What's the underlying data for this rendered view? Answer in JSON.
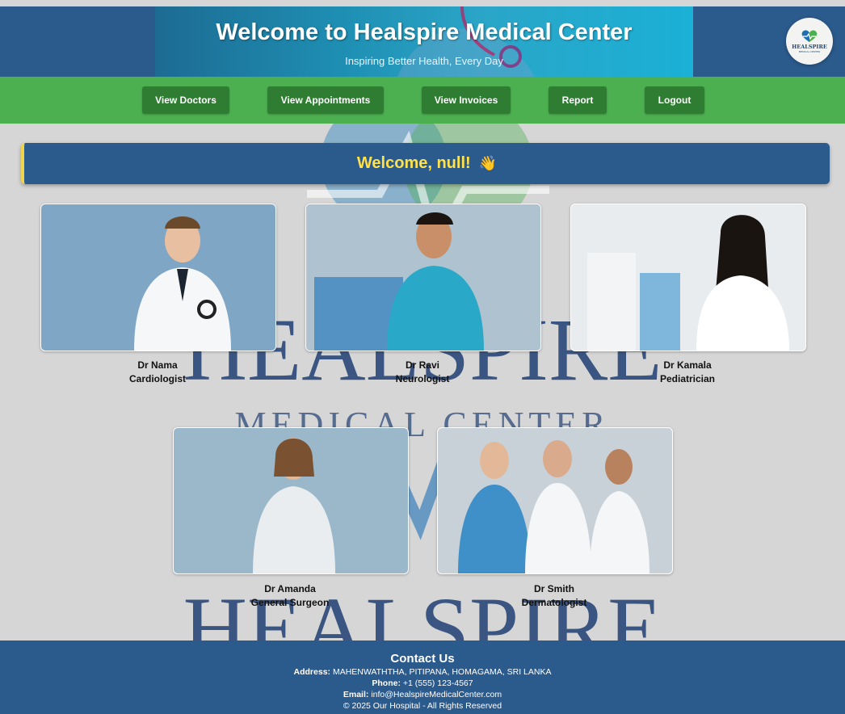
{
  "header": {
    "title": "Welcome to Healspire Medical Center",
    "subtitle": "Inspiring Better Health, Every Day",
    "logo_text": "HEALSPIRE",
    "logo_sub": "MEDICAL CENTER"
  },
  "watermark": {
    "line1": "HEALSPIRE",
    "line2": "MEDICAL CENTER"
  },
  "nav": {
    "items": [
      {
        "label": "View Doctors"
      },
      {
        "label": "View Appointments"
      },
      {
        "label": "View Invoices"
      },
      {
        "label": "Report"
      },
      {
        "label": "Logout"
      }
    ]
  },
  "welcome": {
    "text": "Welcome, null!",
    "emoji": "👋"
  },
  "doctors": [
    {
      "name": "Dr Nama",
      "specialty": "Cardiologist"
    },
    {
      "name": "Dr Ravi",
      "specialty": "Neurologist"
    },
    {
      "name": "Dr Kamala",
      "specialty": "Pediatrician"
    },
    {
      "name": "Dr Amanda",
      "specialty": "General Surgeon"
    },
    {
      "name": "Dr Smith",
      "specialty": "Dermatologist"
    }
  ],
  "footer": {
    "title": "Contact Us",
    "address_label": "Address:",
    "address": "MAHENWATHTHA, PITIPANA, HOMAGAMA, SRI LANKA",
    "phone_label": "Phone:",
    "phone": "+1 (555) 123-4567",
    "email_label": "Email:",
    "email": "info@HealspireMedicalCenter.com",
    "copyright": "© 2025 Our Hospital - All Rights Reserved"
  },
  "colors": {
    "header_bg": "#2b5a8c",
    "nav_bg": "#4caf50",
    "nav_button": "#2e7d32",
    "welcome_text": "#ffe14a"
  }
}
